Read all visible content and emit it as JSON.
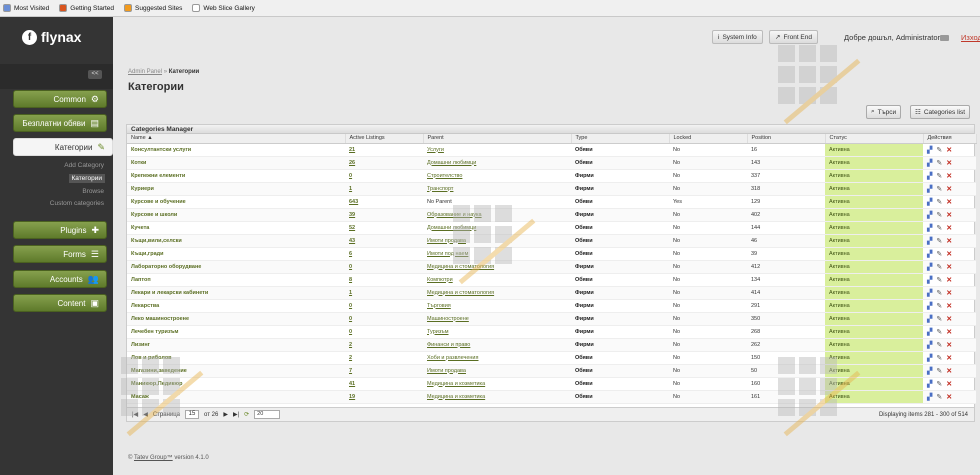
{
  "bookmarks": [
    {
      "label": "Most Visited",
      "icon": "gear-icon",
      "color": "#6b8fd6"
    },
    {
      "label": "Getting Started",
      "icon": "firefox-icon",
      "color": "#d9541e"
    },
    {
      "label": "Suggested Sites",
      "icon": "rss-icon",
      "color": "#f29b1e"
    },
    {
      "label": "Web Slice Gallery",
      "icon": "page-icon",
      "color": "#ffffff"
    }
  ],
  "brand": "flynax",
  "collapse": "<<",
  "nav": {
    "common": "Common",
    "free_ads": "Безплатни обяви",
    "categories": "Категории",
    "sub": {
      "add": "Add Category",
      "list": "Категории",
      "browse": "Browse",
      "custom": "Custom categories"
    },
    "plugins": "Plugins",
    "forms": "Forms",
    "accounts": "Accounts",
    "content": "Content"
  },
  "header": {
    "system_info": "System Info",
    "front_end": "Front End",
    "welcome": "Добре дошъл, Administrator",
    "logout": "Изход"
  },
  "breadcrumb": {
    "root": "Admin Panel",
    "sep": "»",
    "current": "Категории"
  },
  "page_title": "Категории",
  "actions": {
    "search": "Търси",
    "list": "Categories list"
  },
  "grid": {
    "title": "Categories Manager",
    "columns": [
      "Name ▲",
      "Active Listings",
      "Parent",
      "Type",
      "Locked",
      "Position",
      "Статус",
      "Действия"
    ],
    "rows": [
      [
        "Консултантски услуги",
        "21",
        "Услуги",
        "Обяви",
        "No",
        "16",
        "Активна"
      ],
      [
        "Котки",
        "26",
        "Домашни любимци",
        "Обяви",
        "No",
        "143",
        "Активна"
      ],
      [
        "Крепежни елементи",
        "0",
        "Строителство",
        "Фирми",
        "No",
        "337",
        "Активна"
      ],
      [
        "Куриери",
        "1",
        "Транспорт",
        "Фирми",
        "No",
        "318",
        "Активна"
      ],
      [
        "Курсове и обучение",
        "643",
        "No Parent",
        "Обяви",
        "Yes",
        "129",
        "Активна"
      ],
      [
        "Курсове и школи",
        "39",
        "Образование и наука",
        "Фирми",
        "No",
        "402",
        "Активна"
      ],
      [
        "Кучета",
        "52",
        "Домашни любимци",
        "Обяви",
        "No",
        "144",
        "Активна"
      ],
      [
        "Къщи,вили,селски",
        "43",
        "Имоти продава",
        "Обяви",
        "No",
        "46",
        "Активна"
      ],
      [
        "Къщи,гради",
        "6",
        "Имоти под наем",
        "Обяви",
        "No",
        "39",
        "Активна"
      ],
      [
        "Лабораторно оборудване",
        "0",
        "Медицина и стоматология",
        "Фирми",
        "No",
        "412",
        "Активна"
      ],
      [
        "Лаптоп",
        "8",
        "Компютри",
        "Обяви",
        "No",
        "134",
        "Активна"
      ],
      [
        "Лекари и лекарски кабинети",
        "1",
        "Медицина и стоматология",
        "Фирми",
        "No",
        "414",
        "Активна"
      ],
      [
        "Лекарства",
        "0",
        "Търговия",
        "Фирми",
        "No",
        "291",
        "Активна"
      ],
      [
        "Леко машиностроене",
        "0",
        "Машиностроене",
        "Фирми",
        "No",
        "350",
        "Активна"
      ],
      [
        "Лечебен туризъм",
        "0",
        "Туризъм",
        "Фирми",
        "No",
        "268",
        "Активна"
      ],
      [
        "Лизинг",
        "2",
        "Финанси и право",
        "Фирми",
        "No",
        "262",
        "Активна"
      ],
      [
        "Лов и риболов",
        "2",
        "Хоби и развлечения",
        "Обяви",
        "No",
        "150",
        "Активна"
      ],
      [
        "Магазини,заведение",
        "7",
        "Имоти продава",
        "Обяви",
        "No",
        "50",
        "Активна"
      ],
      [
        "Маникюр,Педикюр",
        "41",
        "Медицина и козметика",
        "Обяви",
        "No",
        "160",
        "Активна"
      ],
      [
        "Масаж",
        "19",
        "Медицина и козметика",
        "Обяви",
        "No",
        "161",
        "Активна"
      ]
    ]
  },
  "pager": {
    "page_label": "Страница",
    "page": "15",
    "of": "от 26",
    "per_page": "20",
    "display": "Displaying items 281 - 300 of 514"
  },
  "footer": {
    "brand": "Tatev Group™",
    "version": "version 4.1.0"
  }
}
